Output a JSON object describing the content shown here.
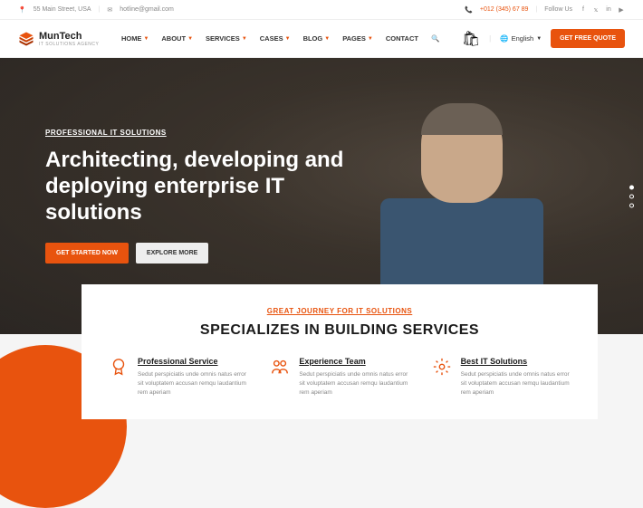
{
  "topbar": {
    "address": "55 Main Street, USA",
    "email": "hotline@gmail.com",
    "phone": "+012 (345) 67 89",
    "follow": "Follow Us"
  },
  "brand": {
    "name": "MunTech",
    "tagline": "IT SOLUTIONS AGENCY"
  },
  "nav": {
    "items": [
      "HOME",
      "ABOUT",
      "SERVICES",
      "CASES",
      "BLOG",
      "PAGES",
      "CONTACT"
    ]
  },
  "lang": {
    "label": "English"
  },
  "quote": "GET FREE QUOTE",
  "hero": {
    "eyebrow": "PROFESSIONAL IT SOLUTIONS",
    "title": "Architecting, developing and deploying enterprise IT solutions",
    "cta_primary": "GET STARTED NOW",
    "cta_secondary": "EXPLORE MORE"
  },
  "services": {
    "eyebrow": "GREAT JOURNEY FOR IT SOLUTIONS",
    "title": "SPECIALIZES IN BUILDING SERVICES",
    "cards": [
      {
        "name": "Professional Service",
        "desc": "Sedut perspiciatis unde omnis natus error sit voluptatem accusan remqu laudantium rem aperiam"
      },
      {
        "name": "Experience Team",
        "desc": "Sedut perspiciatis unde omnis natus error sit voluptatem accusan remqu laudantium rem aperiam"
      },
      {
        "name": "Best IT Solutions",
        "desc": "Sedut perspiciatis unde omnis natus error sit voluptatem accusan remqu laudantium rem aperiam"
      }
    ]
  }
}
